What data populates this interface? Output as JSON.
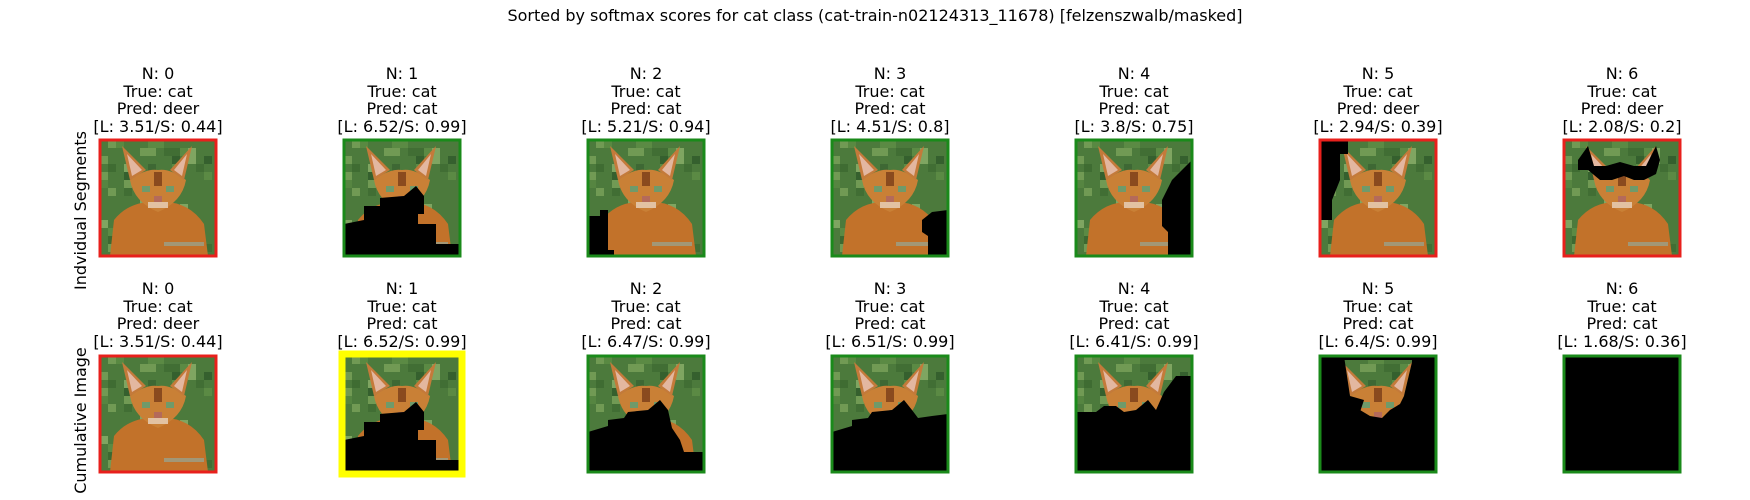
{
  "chart_data": {
    "type": "image-grid",
    "title": "Sorted by softmax scores for cat class (cat-train-n02124313_11678) [felzenszwalb/masked]",
    "row_labels": [
      "Indvidual Segments",
      "Cumulative Image"
    ],
    "border_colors": {
      "correct": "#1a8a1a",
      "wrong": "#e8201c",
      "best": "#ffff00"
    },
    "rows": [
      {
        "name": "Indvidual Segments",
        "cells": [
          {
            "n": "N: 0",
            "true": "True: cat",
            "pred": "Pred: deer",
            "ls": "[L: 3.51/S: 0.44]",
            "border": "wrong",
            "mask": "none"
          },
          {
            "n": "N: 1",
            "true": "True: cat",
            "pred": "Pred: cat",
            "ls": "[L: 6.52/S: 0.99]",
            "border": "correct",
            "mask": "s1"
          },
          {
            "n": "N: 2",
            "true": "True: cat",
            "pred": "Pred: cat",
            "ls": "[L: 5.21/S: 0.94]",
            "border": "correct",
            "mask": "s2"
          },
          {
            "n": "N: 3",
            "true": "True: cat",
            "pred": "Pred: cat",
            "ls": "[L: 4.51/S: 0.8]",
            "border": "correct",
            "mask": "s3"
          },
          {
            "n": "N: 4",
            "true": "True: cat",
            "pred": "Pred: cat",
            "ls": "[L: 3.8/S: 0.75]",
            "border": "correct",
            "mask": "s4"
          },
          {
            "n": "N: 5",
            "true": "True: cat",
            "pred": "Pred: deer",
            "ls": "[L: 2.94/S: 0.39]",
            "border": "wrong",
            "mask": "s5"
          },
          {
            "n": "N: 6",
            "true": "True: cat",
            "pred": "Pred: deer",
            "ls": "[L: 2.08/S: 0.2]",
            "border": "wrong",
            "mask": "s6"
          }
        ]
      },
      {
        "name": "Cumulative Image",
        "cells": [
          {
            "n": "N: 0",
            "true": "True: cat",
            "pred": "Pred: deer",
            "ls": "[L: 3.51/S: 0.44]",
            "border": "wrong",
            "mask": "none"
          },
          {
            "n": "N: 1",
            "true": "True: cat",
            "pred": "Pred: cat",
            "ls": "[L: 6.52/S: 0.99]",
            "border": "best",
            "mask": "c1"
          },
          {
            "n": "N: 2",
            "true": "True: cat",
            "pred": "Pred: cat",
            "ls": "[L: 6.47/S: 0.99]",
            "border": "correct",
            "mask": "c2"
          },
          {
            "n": "N: 3",
            "true": "True: cat",
            "pred": "Pred: cat",
            "ls": "[L: 6.51/S: 0.99]",
            "border": "correct",
            "mask": "c3"
          },
          {
            "n": "N: 4",
            "true": "True: cat",
            "pred": "Pred: cat",
            "ls": "[L: 6.41/S: 0.99]",
            "border": "correct",
            "mask": "c4"
          },
          {
            "n": "N: 5",
            "true": "True: cat",
            "pred": "Pred: cat",
            "ls": "[L: 6.4/S: 0.99]",
            "border": "correct",
            "mask": "c5"
          },
          {
            "n": "N: 6",
            "true": "True: cat",
            "pred": "Pred: cat",
            "ls": "[L: 1.68/S: 0.36]",
            "border": "correct",
            "mask": "c6"
          }
        ]
      }
    ]
  }
}
